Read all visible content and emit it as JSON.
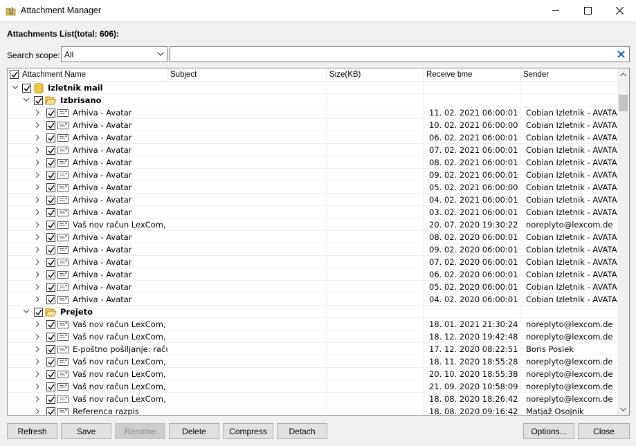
{
  "window": {
    "title": "Attachment Manager",
    "icon": "folder-paperclip-icon"
  },
  "header": {
    "list_title": "Attachments List(total: 606):"
  },
  "search": {
    "scope_label": "Search scope:",
    "scope_value": "All",
    "query": ""
  },
  "columns": {
    "name": "Attachment Name",
    "subject": "Subject",
    "size": "Size(KB)",
    "time": "Receive time",
    "sender": "Sender"
  },
  "tree": {
    "root": "Izletnik mail",
    "folder1": "Izbrisano",
    "folder2": "Prejeto"
  },
  "rows1": [
    {
      "name": "Arhiva - Avatar",
      "time": "11. 02. 2021 06:00:01",
      "sender": "Cobian Izletnik - AVATAR"
    },
    {
      "name": "Arhiva - Avatar",
      "time": "10. 02. 2021 06:00:00",
      "sender": "Cobian Izletnik - AVATAR"
    },
    {
      "name": "Arhiva - Avatar",
      "time": "06. 02. 2021 06:00:01",
      "sender": "Cobian Izletnik - AVATAR"
    },
    {
      "name": "Arhiva - Avatar",
      "time": "07. 02. 2021 06:00:01",
      "sender": "Cobian Izletnik - AVATAR"
    },
    {
      "name": "Arhiva - Avatar",
      "time": "08. 02. 2021 06:00:01",
      "sender": "Cobian Izletnik - AVATAR"
    },
    {
      "name": "Arhiva - Avatar",
      "time": "09. 02. 2021 06:00:01",
      "sender": "Cobian Izletnik - AVATAR"
    },
    {
      "name": "Arhiva - Avatar",
      "time": "05. 02. 2021 06:00:00",
      "sender": "Cobian Izletnik - AVATAR"
    },
    {
      "name": "Arhiva - Avatar",
      "time": "04. 02. 2021 06:00:01",
      "sender": "Cobian Izletnik - AVATAR"
    },
    {
      "name": "Arhiva - Avatar",
      "time": "03. 02. 2021 06:00:01",
      "sender": "Cobian Izletnik - AVATAR"
    },
    {
      "name": "Vaš nov račun LexCom, ID",
      "time": "20. 07. 2020 19:30:22",
      "sender": "noreplyto@lexcom.de"
    },
    {
      "name": "Arhiva - Avatar",
      "time": "08. 02. 2020 06:00:01",
      "sender": "Cobian Izletnik - AVATAR"
    },
    {
      "name": "Arhiva - Avatar",
      "time": "09. 02. 2020 06:00:01",
      "sender": "Cobian Izletnik - AVATAR"
    },
    {
      "name": "Arhiva - Avatar",
      "time": "07. 02. 2020 06:00:01",
      "sender": "Cobian Izletnik - AVATAR"
    },
    {
      "name": "Arhiva - Avatar",
      "time": "06. 02. 2020 06:00:01",
      "sender": "Cobian Izletnik - AVATAR"
    },
    {
      "name": "Arhiva - Avatar",
      "time": "05. 02. 2020 06:00:01",
      "sender": "Cobian Izletnik - AVATAR"
    },
    {
      "name": "Arhiva - Avatar",
      "time": "04. 02. 2020 06:00:01",
      "sender": "Cobian Izletnik - AVATAR"
    }
  ],
  "rows2": [
    {
      "name": "Vaš nov račun LexCom, ID",
      "time": "18. 01. 2021 21:30:24",
      "sender": "noreplyto@lexcom.de"
    },
    {
      "name": "Vaš nov račun LexCom, ID",
      "time": "18. 12. 2020 19:42:48",
      "sender": "noreplyto@lexcom.de"
    },
    {
      "name": "E-poštno pošiljanje: raču",
      "time": "17. 12. 2020 08:22:51",
      "sender": "Boris Poslek"
    },
    {
      "name": "Vaš nov račun LexCom, ID",
      "time": "18. 11. 2020 18:55:28",
      "sender": "noreplyto@lexcom.de"
    },
    {
      "name": "Vaš nov račun LexCom, ID",
      "time": "20. 10. 2020 18:55:38",
      "sender": "noreplyto@lexcom.de"
    },
    {
      "name": "Vaš nov račun LexCom, ID",
      "time": "21. 09. 2020 10:58:09",
      "sender": "noreplyto@lexcom.de"
    },
    {
      "name": "Vaš nov račun LexCom, ID",
      "time": "18. 08. 2020 18:26:42",
      "sender": "noreplyto@lexcom.de"
    },
    {
      "name": "Referenca razpis",
      "time": "18. 08. 2020 09:16:42",
      "sender": "Matjaž Osojnik"
    }
  ],
  "buttons": {
    "refresh": "Refresh",
    "save": "Save",
    "rename": "Rename",
    "delete": "Delete",
    "compress": "Compress",
    "detach": "Detach",
    "options": "Options...",
    "close": "Close"
  }
}
